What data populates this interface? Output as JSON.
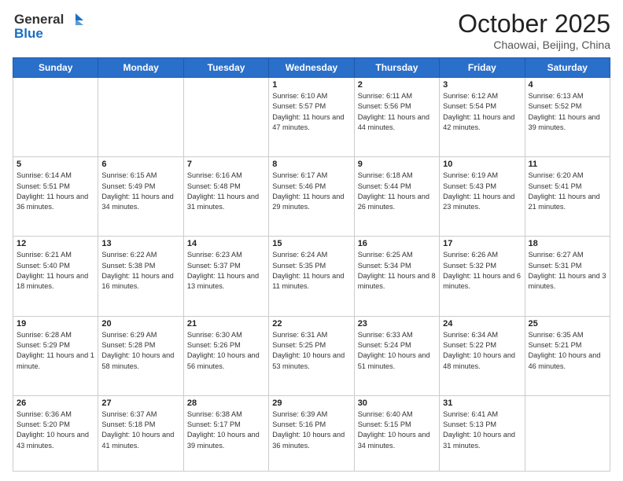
{
  "header": {
    "logo_general": "General",
    "logo_blue": "Blue",
    "month_title": "October 2025",
    "location": "Chaowai, Beijing, China"
  },
  "days_of_week": [
    "Sunday",
    "Monday",
    "Tuesday",
    "Wednesday",
    "Thursday",
    "Friday",
    "Saturday"
  ],
  "weeks": [
    [
      {
        "day": "",
        "sunrise": "",
        "sunset": "",
        "daylight": ""
      },
      {
        "day": "",
        "sunrise": "",
        "sunset": "",
        "daylight": ""
      },
      {
        "day": "",
        "sunrise": "",
        "sunset": "",
        "daylight": ""
      },
      {
        "day": "1",
        "sunrise": "Sunrise: 6:10 AM",
        "sunset": "Sunset: 5:57 PM",
        "daylight": "Daylight: 11 hours and 47 minutes."
      },
      {
        "day": "2",
        "sunrise": "Sunrise: 6:11 AM",
        "sunset": "Sunset: 5:56 PM",
        "daylight": "Daylight: 11 hours and 44 minutes."
      },
      {
        "day": "3",
        "sunrise": "Sunrise: 6:12 AM",
        "sunset": "Sunset: 5:54 PM",
        "daylight": "Daylight: 11 hours and 42 minutes."
      },
      {
        "day": "4",
        "sunrise": "Sunrise: 6:13 AM",
        "sunset": "Sunset: 5:52 PM",
        "daylight": "Daylight: 11 hours and 39 minutes."
      }
    ],
    [
      {
        "day": "5",
        "sunrise": "Sunrise: 6:14 AM",
        "sunset": "Sunset: 5:51 PM",
        "daylight": "Daylight: 11 hours and 36 minutes."
      },
      {
        "day": "6",
        "sunrise": "Sunrise: 6:15 AM",
        "sunset": "Sunset: 5:49 PM",
        "daylight": "Daylight: 11 hours and 34 minutes."
      },
      {
        "day": "7",
        "sunrise": "Sunrise: 6:16 AM",
        "sunset": "Sunset: 5:48 PM",
        "daylight": "Daylight: 11 hours and 31 minutes."
      },
      {
        "day": "8",
        "sunrise": "Sunrise: 6:17 AM",
        "sunset": "Sunset: 5:46 PM",
        "daylight": "Daylight: 11 hours and 29 minutes."
      },
      {
        "day": "9",
        "sunrise": "Sunrise: 6:18 AM",
        "sunset": "Sunset: 5:44 PM",
        "daylight": "Daylight: 11 hours and 26 minutes."
      },
      {
        "day": "10",
        "sunrise": "Sunrise: 6:19 AM",
        "sunset": "Sunset: 5:43 PM",
        "daylight": "Daylight: 11 hours and 23 minutes."
      },
      {
        "day": "11",
        "sunrise": "Sunrise: 6:20 AM",
        "sunset": "Sunset: 5:41 PM",
        "daylight": "Daylight: 11 hours and 21 minutes."
      }
    ],
    [
      {
        "day": "12",
        "sunrise": "Sunrise: 6:21 AM",
        "sunset": "Sunset: 5:40 PM",
        "daylight": "Daylight: 11 hours and 18 minutes."
      },
      {
        "day": "13",
        "sunrise": "Sunrise: 6:22 AM",
        "sunset": "Sunset: 5:38 PM",
        "daylight": "Daylight: 11 hours and 16 minutes."
      },
      {
        "day": "14",
        "sunrise": "Sunrise: 6:23 AM",
        "sunset": "Sunset: 5:37 PM",
        "daylight": "Daylight: 11 hours and 13 minutes."
      },
      {
        "day": "15",
        "sunrise": "Sunrise: 6:24 AM",
        "sunset": "Sunset: 5:35 PM",
        "daylight": "Daylight: 11 hours and 11 minutes."
      },
      {
        "day": "16",
        "sunrise": "Sunrise: 6:25 AM",
        "sunset": "Sunset: 5:34 PM",
        "daylight": "Daylight: 11 hours and 8 minutes."
      },
      {
        "day": "17",
        "sunrise": "Sunrise: 6:26 AM",
        "sunset": "Sunset: 5:32 PM",
        "daylight": "Daylight: 11 hours and 6 minutes."
      },
      {
        "day": "18",
        "sunrise": "Sunrise: 6:27 AM",
        "sunset": "Sunset: 5:31 PM",
        "daylight": "Daylight: 11 hours and 3 minutes."
      }
    ],
    [
      {
        "day": "19",
        "sunrise": "Sunrise: 6:28 AM",
        "sunset": "Sunset: 5:29 PM",
        "daylight": "Daylight: 11 hours and 1 minute."
      },
      {
        "day": "20",
        "sunrise": "Sunrise: 6:29 AM",
        "sunset": "Sunset: 5:28 PM",
        "daylight": "Daylight: 10 hours and 58 minutes."
      },
      {
        "day": "21",
        "sunrise": "Sunrise: 6:30 AM",
        "sunset": "Sunset: 5:26 PM",
        "daylight": "Daylight: 10 hours and 56 minutes."
      },
      {
        "day": "22",
        "sunrise": "Sunrise: 6:31 AM",
        "sunset": "Sunset: 5:25 PM",
        "daylight": "Daylight: 10 hours and 53 minutes."
      },
      {
        "day": "23",
        "sunrise": "Sunrise: 6:33 AM",
        "sunset": "Sunset: 5:24 PM",
        "daylight": "Daylight: 10 hours and 51 minutes."
      },
      {
        "day": "24",
        "sunrise": "Sunrise: 6:34 AM",
        "sunset": "Sunset: 5:22 PM",
        "daylight": "Daylight: 10 hours and 48 minutes."
      },
      {
        "day": "25",
        "sunrise": "Sunrise: 6:35 AM",
        "sunset": "Sunset: 5:21 PM",
        "daylight": "Daylight: 10 hours and 46 minutes."
      }
    ],
    [
      {
        "day": "26",
        "sunrise": "Sunrise: 6:36 AM",
        "sunset": "Sunset: 5:20 PM",
        "daylight": "Daylight: 10 hours and 43 minutes."
      },
      {
        "day": "27",
        "sunrise": "Sunrise: 6:37 AM",
        "sunset": "Sunset: 5:18 PM",
        "daylight": "Daylight: 10 hours and 41 minutes."
      },
      {
        "day": "28",
        "sunrise": "Sunrise: 6:38 AM",
        "sunset": "Sunset: 5:17 PM",
        "daylight": "Daylight: 10 hours and 39 minutes."
      },
      {
        "day": "29",
        "sunrise": "Sunrise: 6:39 AM",
        "sunset": "Sunset: 5:16 PM",
        "daylight": "Daylight: 10 hours and 36 minutes."
      },
      {
        "day": "30",
        "sunrise": "Sunrise: 6:40 AM",
        "sunset": "Sunset: 5:15 PM",
        "daylight": "Daylight: 10 hours and 34 minutes."
      },
      {
        "day": "31",
        "sunrise": "Sunrise: 6:41 AM",
        "sunset": "Sunset: 5:13 PM",
        "daylight": "Daylight: 10 hours and 31 minutes."
      },
      {
        "day": "",
        "sunrise": "",
        "sunset": "",
        "daylight": ""
      }
    ]
  ]
}
